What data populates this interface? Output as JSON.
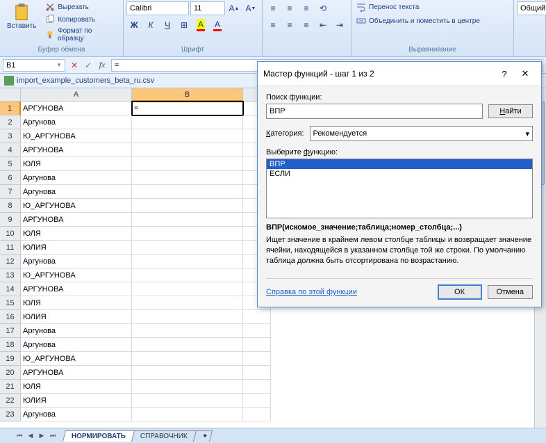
{
  "ribbon": {
    "clipboard": {
      "paste": "Вставить",
      "cut": "Вырезать",
      "copy": "Копировать",
      "format_painter": "Формат по образцу",
      "group": "Буфер обмена"
    },
    "font": {
      "name": "Calibri",
      "size": "11",
      "group": "Шрифт"
    },
    "alignment": {
      "wrap": "Перенос текста",
      "merge": "Объединить и поместить в центре",
      "group": "Выравнивание"
    },
    "number": {
      "format": "Общий"
    }
  },
  "formula_bar": {
    "cell_ref": "B1",
    "formula": "="
  },
  "document": {
    "name": "import_example_customers_beta_ru.csv"
  },
  "columns": [
    "A",
    "B"
  ],
  "rows": [
    "АРГУНОВА",
    "Аргунова",
    "Ю_АРГУНОВА",
    " АРГУНОВА",
    "ЮЛЯ",
    "Аргунова",
    "Аргунова",
    "Ю_АРГУНОВА",
    " АРГУНОВА",
    "ЮЛЯ",
    "ЮЛИЯ",
    "Аргунова",
    "Ю_АРГУНОВА",
    " АРГУНОВА",
    "ЮЛЯ",
    "ЮЛИЯ",
    "Аргунова",
    "Аргунова",
    "Ю_АРГУНОВА",
    " АРГУНОВА",
    "ЮЛЯ",
    "ЮЛИЯ",
    "Аргунова"
  ],
  "active_cell_value": "=",
  "sheet_tabs": {
    "active": "НОРМИРОВАТЬ",
    "other": "СПРАВОЧНИК"
  },
  "dialog": {
    "title": "Мастер функций - шаг 1 из 2",
    "search_label": "Поиск функции:",
    "search_value": "ВПР",
    "find": "Найти",
    "category_label": "Категория:",
    "category_value": "Рекомендуется",
    "select_label": "Выберите функцию:",
    "functions": [
      "ВПР",
      "ЕСЛИ"
    ],
    "signature": "ВПР(искомое_значение;таблица;номер_столбца;...)",
    "description": "Ищет значение в крайнем левом столбце таблицы и возвращает значение ячейки, находящейся в указанном столбце той же строки. По умолчанию таблица должна быть отсортирована по возрастанию.",
    "help_link": "Справка по этой функции",
    "ok": "ОК",
    "cancel": "Отмена"
  }
}
